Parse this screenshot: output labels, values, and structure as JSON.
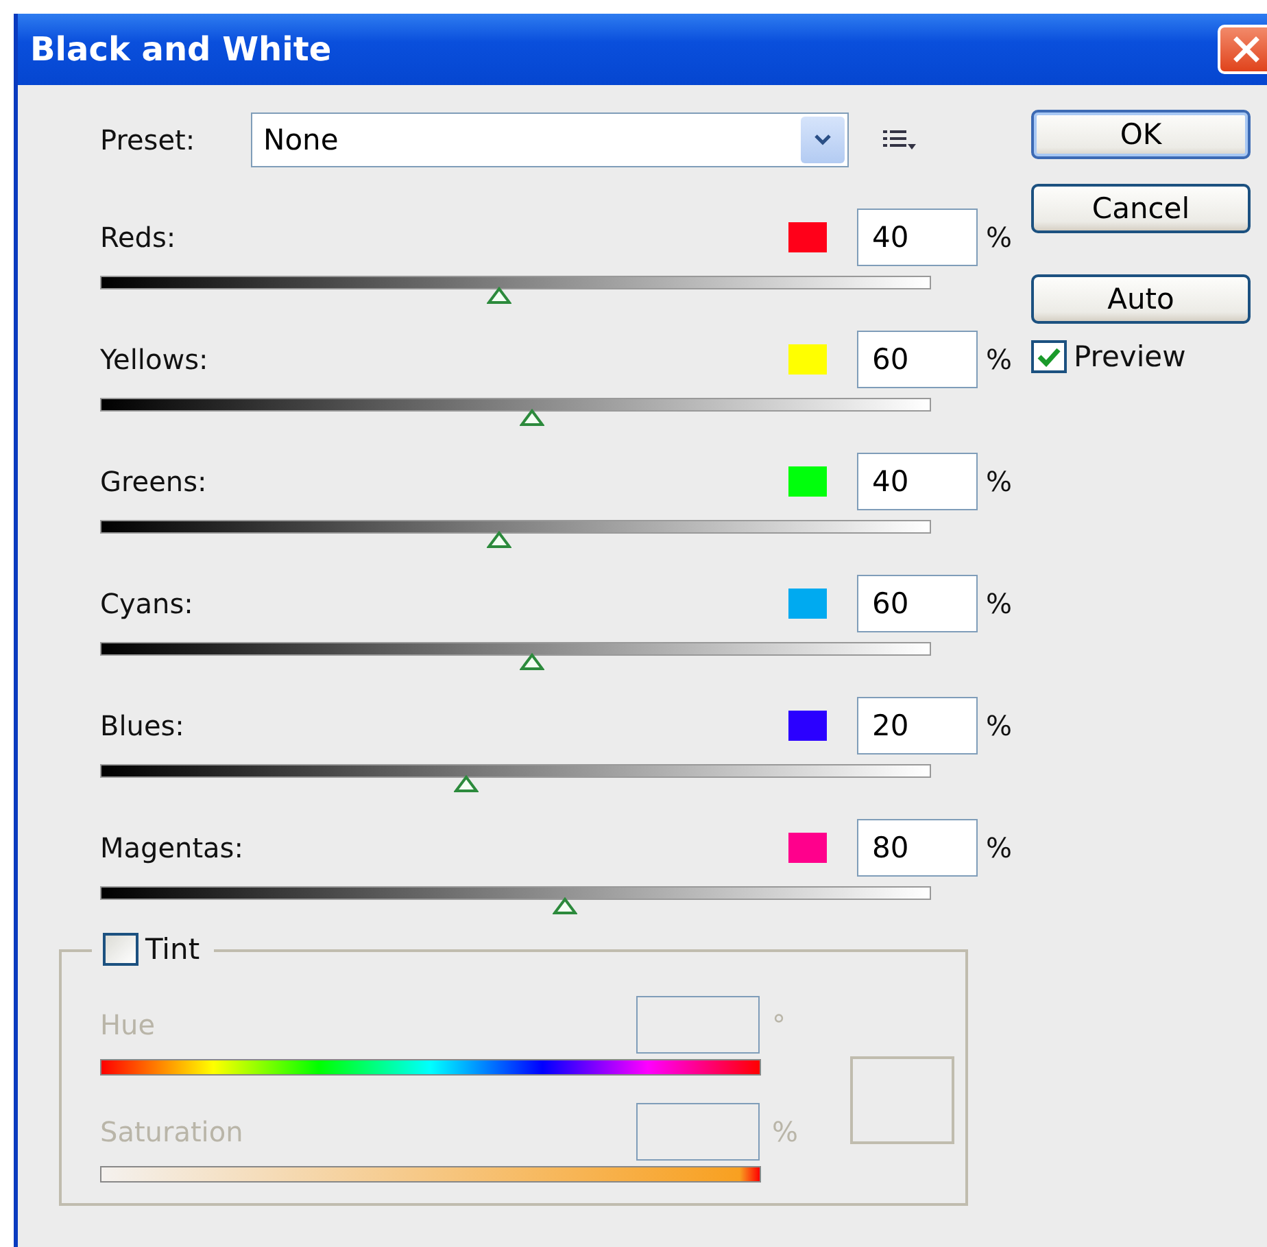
{
  "window": {
    "title": "Black and White"
  },
  "preset": {
    "label": "Preset:",
    "value": "None"
  },
  "channels": [
    {
      "name": "Reds:",
      "color": "#ff0019",
      "value": "40",
      "unit": "%",
      "level": 0.48
    },
    {
      "name": "Yellows:",
      "color": "#ffff00",
      "value": "60",
      "unit": "%",
      "level": 0.52
    },
    {
      "name": "Greens:",
      "color": "#00ff0c",
      "value": "40",
      "unit": "%",
      "level": 0.48
    },
    {
      "name": "Cyans:",
      "color": "#00aaf0",
      "value": "60",
      "unit": "%",
      "level": 0.52
    },
    {
      "name": "Blues:",
      "color": "#2b00ff",
      "value": "20",
      "unit": "%",
      "level": 0.44
    },
    {
      "name": "Magentas:",
      "color": "#ff008c",
      "value": "80",
      "unit": "%",
      "level": 0.56
    }
  ],
  "buttons": [
    {
      "label": "OK",
      "default": true
    },
    {
      "label": "Cancel",
      "default": false
    },
    {
      "label": "Auto",
      "default": false
    }
  ],
  "preview": {
    "label": "Preview",
    "checked": true
  },
  "tint": {
    "label": "Tint",
    "checked": false,
    "fields": [
      {
        "kind": "hue",
        "label": "Hue",
        "unit": "°",
        "disabled": true
      },
      {
        "kind": "saturation",
        "label": "Saturation",
        "unit": "%",
        "disabled": true
      }
    ]
  }
}
